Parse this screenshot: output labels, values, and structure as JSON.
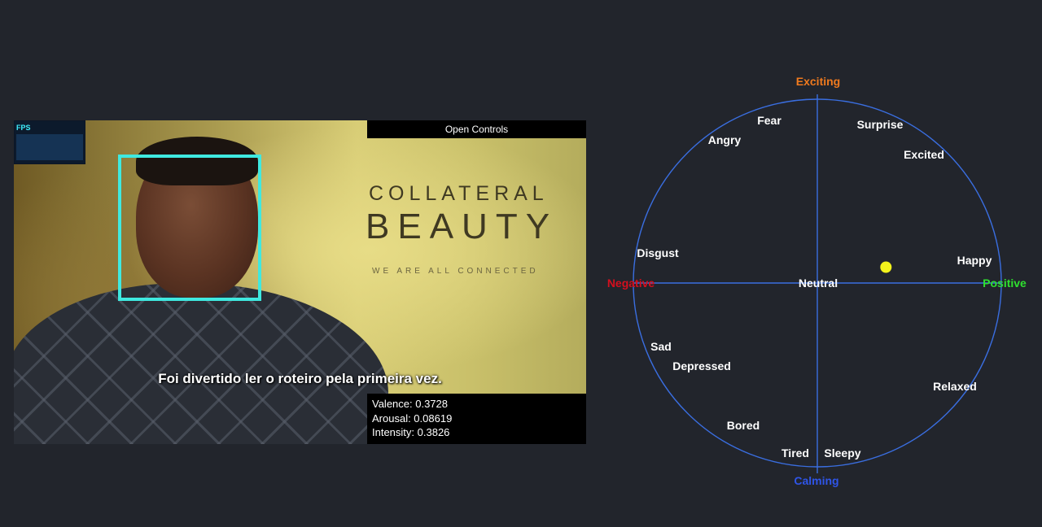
{
  "video": {
    "fps_label": "FPS",
    "open_controls": "Open Controls",
    "subtitle": "Foi divertido ler o roteiro pela primeira vez.",
    "poster": {
      "line1": "COLLATERAL",
      "line2": "BEAUTY",
      "line3": "WE ARE ALL CONNECTED"
    },
    "stats": {
      "valence": "Valence: 0.3728",
      "arousal": "Arousal: 0.08619",
      "intensity": "Intensity: 0.3826"
    }
  },
  "emotion_map": {
    "axes": {
      "top": "Exciting",
      "bottom": "Calming",
      "left": "Negative",
      "right": "Positive",
      "center": "Neutral"
    },
    "axis_colors": {
      "top": "#f07a1e",
      "bottom": "#2f55e8",
      "left": "#d40f1e",
      "right": "#2fe02f",
      "circle": "#3a6ee0",
      "marker": "#f3f31c",
      "emotion_text": "#ffffff"
    },
    "emotions": [
      "Fear",
      "Angry",
      "Surprise",
      "Excited",
      "Disgust",
      "Happy",
      "Sad",
      "Depressed",
      "Relaxed",
      "Bored",
      "Tired",
      "Sleepy"
    ],
    "current_point": {
      "valence": 0.3728,
      "arousal": 0.08619
    }
  }
}
